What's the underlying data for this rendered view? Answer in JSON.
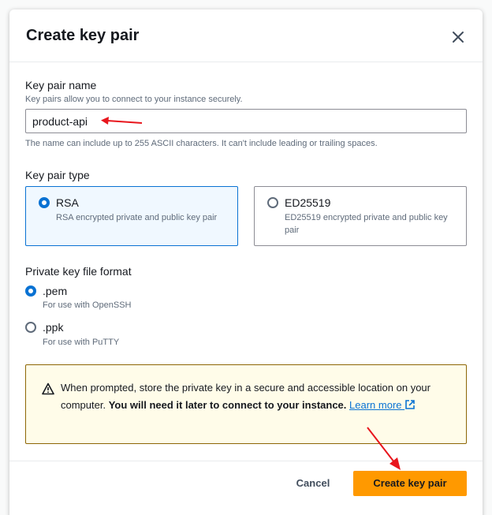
{
  "modal": {
    "title": "Create key pair",
    "key_pair_name": {
      "label": "Key pair name",
      "description": "Key pairs allow you to connect to your instance securely.",
      "value": "product-api",
      "constraint": "The name can include up to 255 ASCII characters. It can't include leading or trailing spaces."
    },
    "key_pair_type": {
      "label": "Key pair type",
      "options": [
        {
          "title": "RSA",
          "description": "RSA encrypted private and public key pair",
          "selected": true
        },
        {
          "title": "ED25519",
          "description": "ED25519 encrypted private and public key pair",
          "selected": false
        }
      ]
    },
    "file_format": {
      "label": "Private key file format",
      "options": [
        {
          "title": ".pem",
          "description": "For use with OpenSSH",
          "selected": true
        },
        {
          "title": ".ppk",
          "description": "For use with PuTTY",
          "selected": false
        }
      ]
    },
    "warning": {
      "text_plain": "When prompted, store the private key in a secure and accessible location on your computer. ",
      "text_bold": "You will need it later to connect to your instance.",
      "link_text": "Learn more"
    },
    "buttons": {
      "cancel": "Cancel",
      "create": "Create key pair"
    }
  },
  "colors": {
    "accent": "#0972d3",
    "primary_button": "#ff9900",
    "warning_border": "#8d6605",
    "warning_bg": "#fffce9",
    "annotation_arrow": "#e8161d"
  },
  "icons": {
    "close": "close-icon",
    "warning": "warning-icon",
    "external_link": "external-link-icon"
  }
}
